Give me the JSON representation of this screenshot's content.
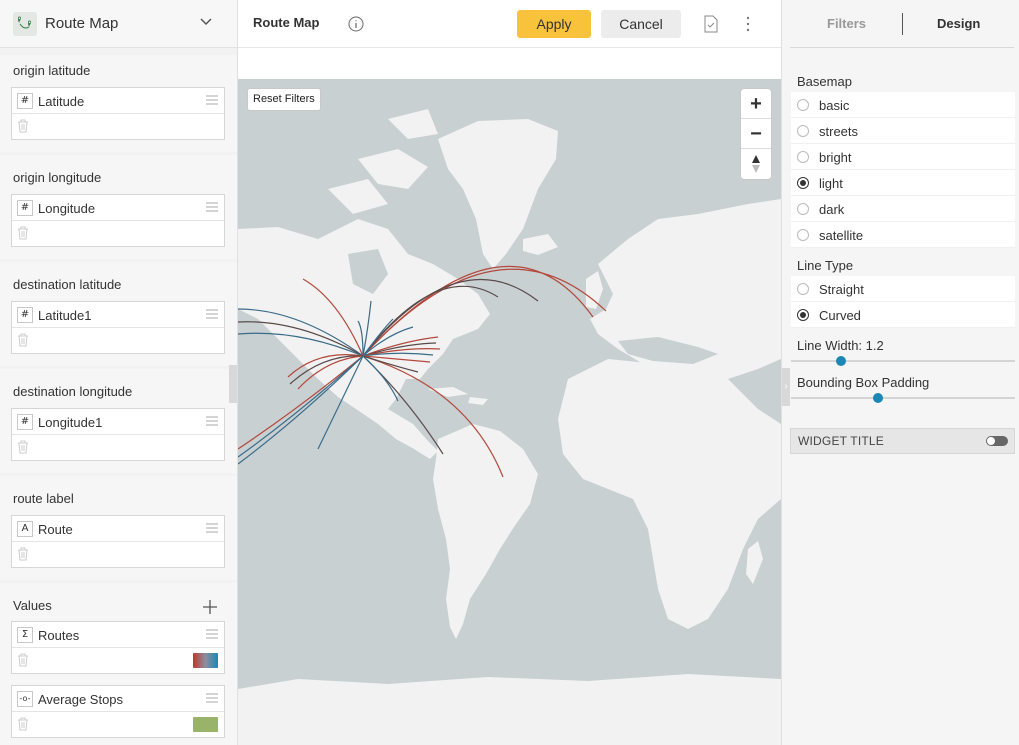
{
  "left_panel": {
    "widget_name": "Route Map",
    "sections": [
      {
        "label": "origin latitude",
        "field": "Latitude",
        "type_tag": "#"
      },
      {
        "label": "origin longitude",
        "field": "Longitude",
        "type_tag": "#"
      },
      {
        "label": "destination latitude",
        "field": "Latitude1",
        "type_tag": "#"
      },
      {
        "label": "destination longitude",
        "field": "Longitude1",
        "type_tag": "#"
      },
      {
        "label": "route label",
        "field": "Route",
        "type_tag": "A"
      }
    ],
    "values": {
      "label": "Values",
      "items": [
        {
          "field": "Routes",
          "type_tag": "Σ",
          "color": "#c0392b"
        },
        {
          "field": "Average Stops",
          "type_tag": "-o-",
          "color": "#9ab36a"
        }
      ]
    }
  },
  "header": {
    "title": "Route Map",
    "apply_label": "Apply",
    "cancel_label": "Cancel"
  },
  "map": {
    "reset_label": "Reset Filters",
    "zoom_in": "+",
    "zoom_out": "−",
    "route_colors": {
      "red": "#b5483c",
      "blue": "#3a6c8a",
      "dark": "#5a4a4a"
    },
    "land_color": "#f1f2f1",
    "water_color": "#c8d0d2"
  },
  "right_panel": {
    "tabs": [
      "Filters",
      "Design"
    ],
    "active_tab": "Design",
    "basemap": {
      "label": "Basemap",
      "options": [
        "basic",
        "streets",
        "bright",
        "light",
        "dark",
        "satellite"
      ],
      "selected": "light"
    },
    "line_type": {
      "label": "Line Type",
      "options": [
        "Straight",
        "Curved"
      ],
      "selected": "Curved"
    },
    "line_width": {
      "label": "Line Width: 1.2",
      "fraction": 0.21
    },
    "bbox_padding": {
      "label": "Bounding Box Padding",
      "fraction": 0.385
    },
    "widget_title": {
      "label": "WIDGET TITLE",
      "enabled": false
    },
    "accent": "#1a87b5"
  }
}
